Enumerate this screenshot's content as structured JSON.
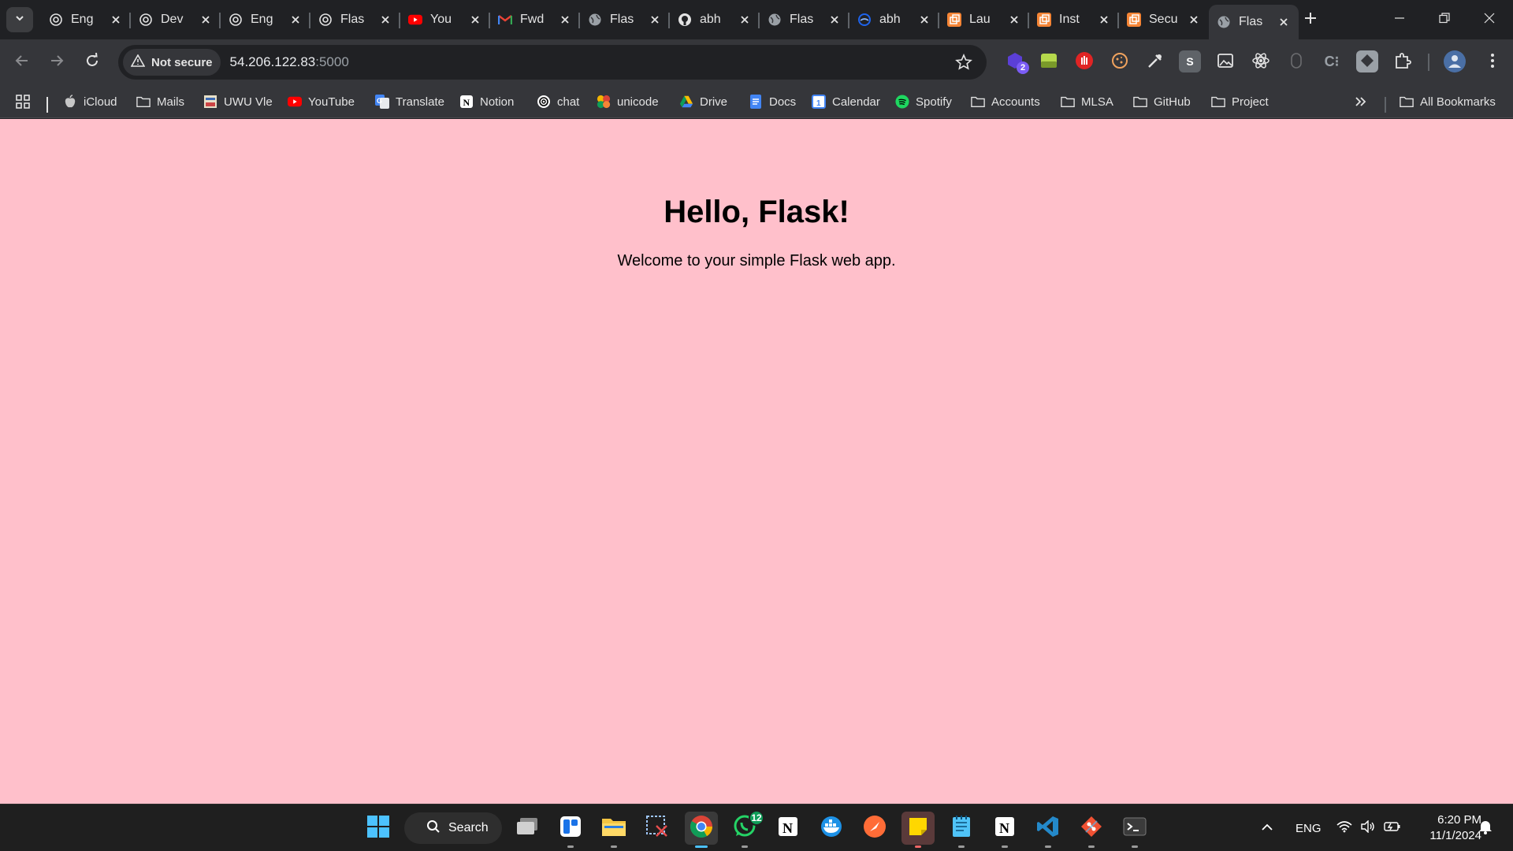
{
  "tabs": [
    {
      "title": "Eng",
      "icon": "openai-icon"
    },
    {
      "title": "Dev",
      "icon": "openai-icon"
    },
    {
      "title": "Eng",
      "icon": "openai-icon"
    },
    {
      "title": "Flas",
      "icon": "openai-icon"
    },
    {
      "title": "You",
      "icon": "youtube-icon"
    },
    {
      "title": "Fwd",
      "icon": "gmail-icon"
    },
    {
      "title": "Flas",
      "icon": "globe-icon"
    },
    {
      "title": "abh",
      "icon": "github-icon"
    },
    {
      "title": "Flas",
      "icon": "globe-icon"
    },
    {
      "title": "abh",
      "icon": "docker-icon"
    },
    {
      "title": "Lau",
      "icon": "aws-icon"
    },
    {
      "title": "Inst",
      "icon": "aws-icon"
    },
    {
      "title": "Secu",
      "icon": "aws-icon"
    },
    {
      "title": "Flas",
      "icon": "globe-icon",
      "active": true
    }
  ],
  "toolbar": {
    "security_label": "Not secure",
    "url_host": "54.206.122.83",
    "url_port": ":5000",
    "extension_badge": "2"
  },
  "bookmarks": {
    "items": [
      {
        "label": "iCloud",
        "icon": "apple-icon"
      },
      {
        "label": "Mails",
        "icon": "folder-icon"
      },
      {
        "label": "UWU Vle",
        "icon": "vle-icon"
      },
      {
        "label": "YouTube",
        "icon": "youtube-icon"
      },
      {
        "label": "Translate",
        "icon": "translate-icon"
      },
      {
        "label": "Notion",
        "icon": "notion-icon"
      },
      {
        "label": "chat",
        "icon": "openai-icon"
      },
      {
        "label": "unicode",
        "icon": "unicode-icon"
      },
      {
        "label": "Drive",
        "icon": "drive-icon"
      },
      {
        "label": "Docs",
        "icon": "docs-icon"
      },
      {
        "label": "Calendar",
        "icon": "calendar-icon"
      },
      {
        "label": "Spotify",
        "icon": "spotify-icon"
      },
      {
        "label": "Accounts",
        "icon": "folder-icon"
      },
      {
        "label": "MLSA",
        "icon": "folder-icon"
      },
      {
        "label": "GitHub",
        "icon": "folder-icon"
      },
      {
        "label": "Project",
        "icon": "folder-icon"
      }
    ],
    "all_bookmarks": "All Bookmarks"
  },
  "page": {
    "heading": "Hello, Flask!",
    "text": "Welcome to your simple Flask web app.",
    "background": "#ffc0cb"
  },
  "taskbar": {
    "search_label": "Search",
    "whatsapp_badge": "12",
    "language": "ENG",
    "time": "6:20 PM",
    "date": "11/1/2024"
  }
}
